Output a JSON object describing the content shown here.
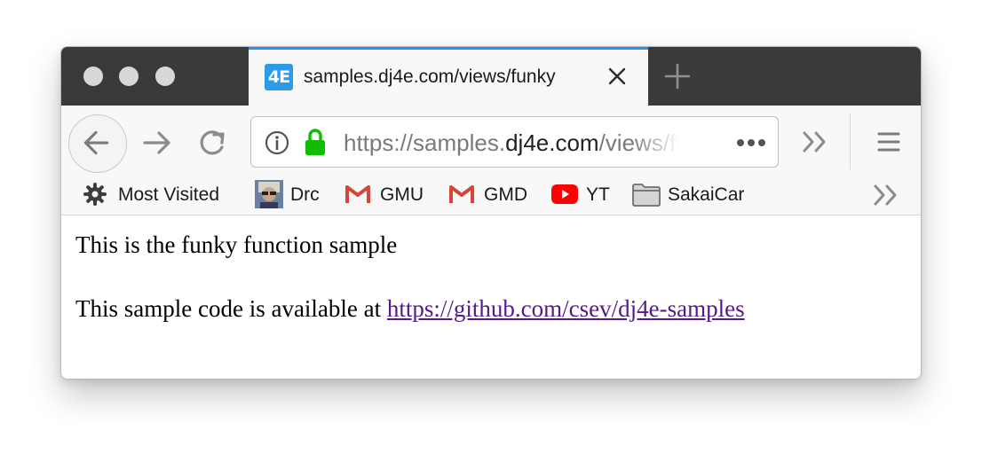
{
  "tab": {
    "favicon_text": "4E",
    "title": "samples.dj4e.com/views/funky"
  },
  "url": {
    "prefix": "https://samples.",
    "host": "dj4e.com",
    "rest": "/views/funky"
  },
  "bookmarks": [
    {
      "label": "Most Visited",
      "icon": "gear-icon"
    },
    {
      "label": "Drc",
      "icon": "avatar-icon"
    },
    {
      "label": "GMU",
      "icon": "gmail-icon"
    },
    {
      "label": "GMD",
      "icon": "gmail-icon"
    },
    {
      "label": "YT",
      "icon": "youtube-icon"
    },
    {
      "label": "SakaiCar",
      "icon": "folder-icon"
    }
  ],
  "content": {
    "line1": "This is the funky function sample",
    "line2_prefix": "This sample code is available at ",
    "link_text": "https://github.com/csev/dj4e-samples"
  },
  "colors": {
    "tab_accent": "#2a8ff3",
    "lock_green": "#12bc00",
    "link_visited": "#551a8b",
    "titlebar": "#3b3a3a"
  }
}
